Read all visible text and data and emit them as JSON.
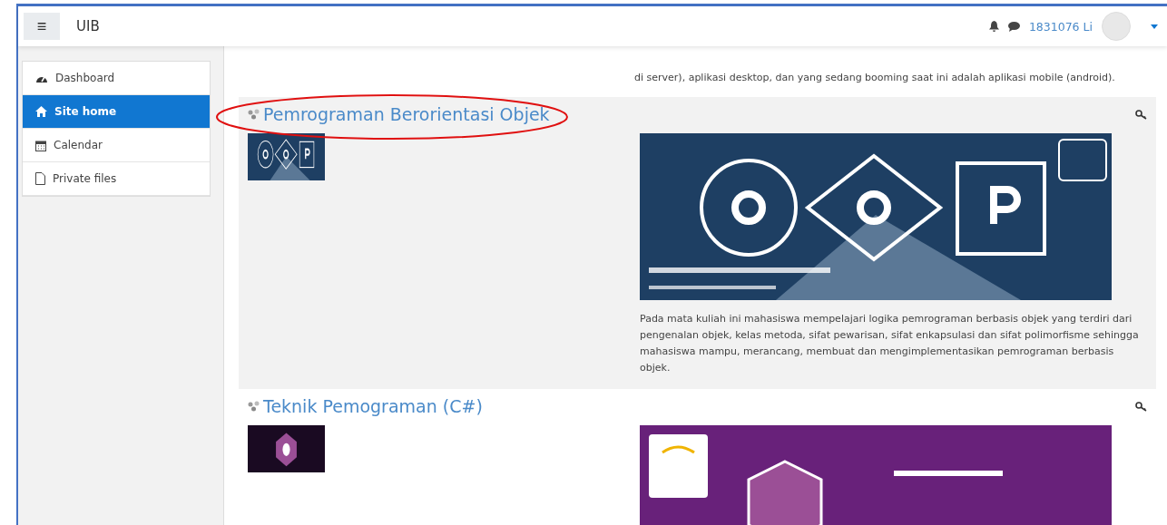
{
  "navbar": {
    "menu_icon": "≡",
    "site_name": "UIB",
    "user_name": "1831076 Li"
  },
  "sidebar": {
    "items": [
      {
        "label": "Dashboard",
        "kind": "dashboard",
        "selected": false
      },
      {
        "label": "Site home",
        "kind": "home",
        "selected": true
      },
      {
        "label": "Calendar",
        "kind": "calendar",
        "selected": false
      },
      {
        "label": "Private files",
        "kind": "file",
        "selected": false
      }
    ]
  },
  "previous_summary": [
    "di server), aplikasi desktop, dan yang sedang booming saat ini adalah aplikasi mobile (android)."
  ],
  "courses": [
    {
      "title": "Pemrograman Berorientasi Objek",
      "kind": "oop",
      "highlighted": true,
      "summary": "Pada mata kuliah ini mahasiswa mempelajari logika pemrograman berbasis objek yang terdiri dari pengenalan objek, kelas metoda, sifat pewarisan, sifat enkapsulasi dan sifat polimorfisme sehingga mahasiswa mampu, merancang, membuat dan mengimplementasikan pemrograman berbasis objek."
    },
    {
      "title": "Teknik Pemograman (C#)",
      "kind": "csharp",
      "highlighted": false
    }
  ]
}
